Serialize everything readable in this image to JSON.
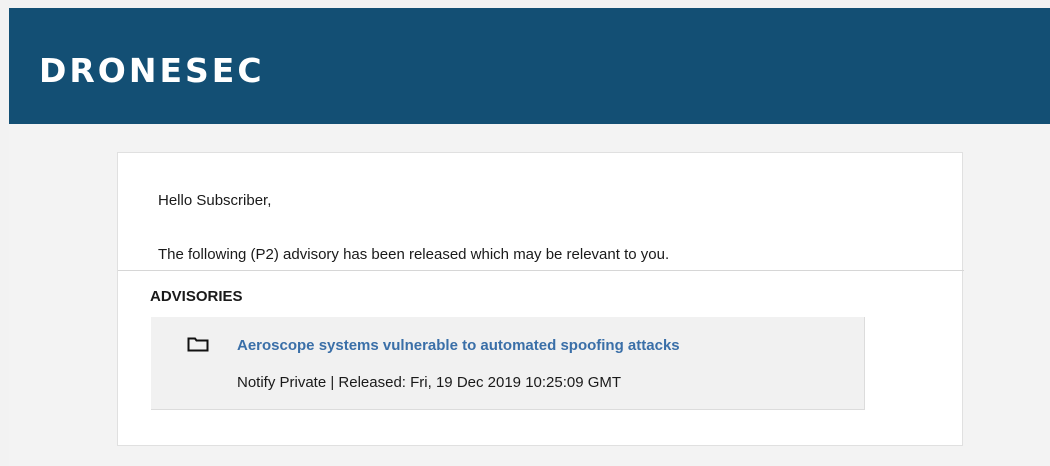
{
  "header": {
    "logo_text": "DRONESEC",
    "background_color": "#134f74"
  },
  "email": {
    "greeting": "Hello Subscriber,",
    "intro": "The following (P2) advisory has been released which may be relevant to you.",
    "section_title": "ADVISORIES",
    "advisories": [
      {
        "icon": "folder-icon",
        "title": "Aeroscope systems vulnerable to automated spoofing attacks",
        "meta": "Notify Private | Released: Fri, 19 Dec 2019 10:25:09 GMT",
        "link_color": "#3a6fa8"
      }
    ]
  }
}
